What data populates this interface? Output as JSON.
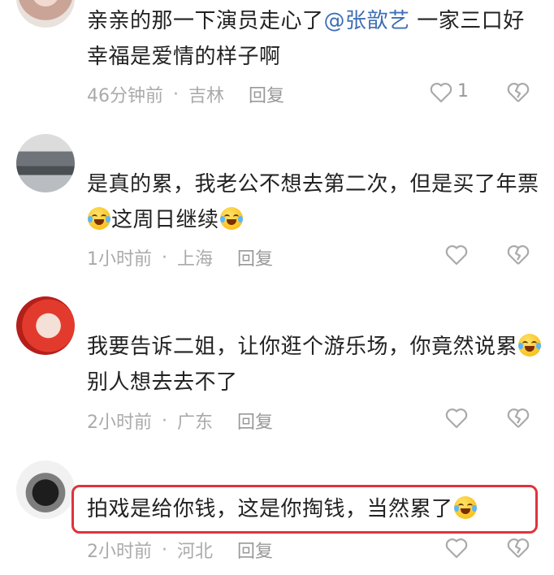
{
  "comments": [
    {
      "text_parts": [
        "亲亲的那一下演员走心了",
        "@张歆艺",
        " 一家三口好幸福是爱情的样子啊"
      ],
      "time": "46分钟前",
      "location": "吉林",
      "reply_label": "回复",
      "like_count": "1"
    },
    {
      "text_parts": [
        "是真的累，我老公不想去第二次，但是买了年票",
        "这周日继续"
      ],
      "time": "1小时前",
      "location": "上海",
      "reply_label": "回复"
    },
    {
      "text_parts": [
        "我要告诉二姐，让你逛个游乐场，你竟然说累",
        "别人想去去不了"
      ],
      "time": "2小时前",
      "location": "广东",
      "reply_label": "回复"
    },
    {
      "text_parts": [
        "拍戏是给你钱，这是你掏钱，当然累了"
      ],
      "time": "2小时前",
      "location": "河北",
      "reply_label": "回复"
    }
  ],
  "separator": "·",
  "colors": {
    "mention": "#3f6fb5",
    "highlight": "#e0333b",
    "meta": "#aaaaaa"
  },
  "icons": {
    "like": "heart-outline-icon",
    "dislike": "broken-heart-icon",
    "emoji": "laugh-cry-emoji"
  }
}
